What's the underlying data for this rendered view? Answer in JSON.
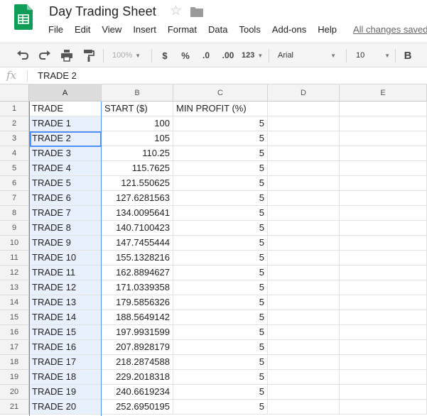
{
  "app": {
    "title": "Day Trading Sheet",
    "menu": [
      "File",
      "Edit",
      "View",
      "Insert",
      "Format",
      "Data",
      "Tools",
      "Add-ons",
      "Help"
    ],
    "save_status": "All changes saved"
  },
  "toolbar": {
    "zoom": "100%",
    "currency": "$",
    "percent": "%",
    "decrease_decimals": ".0",
    "increase_decimals": ".00",
    "number_format": "123",
    "font": "Arial",
    "font_size": "10",
    "bold": "B"
  },
  "formula_bar": {
    "fx_label": "fx",
    "value": "TRADE 2"
  },
  "grid": {
    "columns": [
      "A",
      "B",
      "C",
      "D",
      "E"
    ],
    "selected_column": "A",
    "active_cell": "A3",
    "header_row": [
      "TRADE",
      "START ($)",
      "MIN PROFIT (%)"
    ],
    "rows": [
      [
        "TRADE 1",
        "100",
        "5"
      ],
      [
        "TRADE 2",
        "105",
        "5"
      ],
      [
        "TRADE 3",
        "110.25",
        "5"
      ],
      [
        "TRADE 4",
        "115.7625",
        "5"
      ],
      [
        "TRADE 5",
        "121.550625",
        "5"
      ],
      [
        "TRADE 6",
        "127.6281563",
        "5"
      ],
      [
        "TRADE 7",
        "134.0095641",
        "5"
      ],
      [
        "TRADE 8",
        "140.7100423",
        "5"
      ],
      [
        "TRADE 9",
        "147.7455444",
        "5"
      ],
      [
        "TRADE 10",
        "155.1328216",
        "5"
      ],
      [
        "TRADE 11",
        "162.8894627",
        "5"
      ],
      [
        "TRADE 12",
        "171.0339358",
        "5"
      ],
      [
        "TRADE 13",
        "179.5856326",
        "5"
      ],
      [
        "TRADE 14",
        "188.5649142",
        "5"
      ],
      [
        "TRADE 15",
        "197.9931599",
        "5"
      ],
      [
        "TRADE 16",
        "207.8928179",
        "5"
      ],
      [
        "TRADE 17",
        "218.2874588",
        "5"
      ],
      [
        "TRADE 18",
        "229.2018318",
        "5"
      ],
      [
        "TRADE 19",
        "240.6619234",
        "5"
      ],
      [
        "TRADE 20",
        "252.6950195",
        "5"
      ]
    ]
  },
  "colors": {
    "sheets_green": "#0f9d58",
    "selection_blue": "#4d90fe",
    "selection_fill": "#e8f0fe"
  }
}
